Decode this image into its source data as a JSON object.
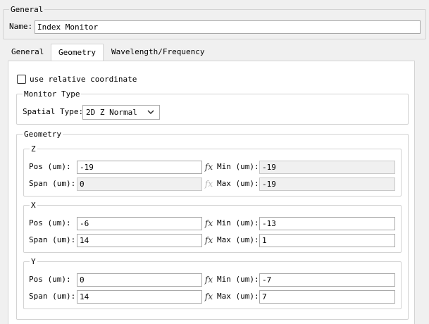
{
  "general": {
    "title": "General",
    "name_label": "Name:",
    "name_value": "Index Monitor"
  },
  "tabs": [
    {
      "label": "General",
      "active": false
    },
    {
      "label": "Geometry",
      "active": true
    },
    {
      "label": "Wavelength/Frequency",
      "active": false
    }
  ],
  "relative_coordinate": {
    "label": "use relative coordinate",
    "checked": false
  },
  "monitor_type": {
    "title": "Monitor Type",
    "spatial_type_label": "Spatial Type:",
    "spatial_type_value": "2D Z Normal"
  },
  "geometry": {
    "title": "Geometry",
    "fx_glyph": "fx",
    "z": {
      "title": "Z",
      "pos_label": "Pos (um):",
      "pos_value": "-19",
      "span_label": "Span (um):",
      "span_value": "0",
      "min_label": "Min (um):",
      "min_value": "-19",
      "max_label": "Max (um):",
      "max_value": "-19"
    },
    "x": {
      "title": "X",
      "pos_label": "Pos (um):",
      "pos_value": "-6",
      "span_label": "Span (um):",
      "span_value": "14",
      "min_label": "Min (um):",
      "min_value": "-13",
      "max_label": "Max (um):",
      "max_value": "1"
    },
    "y": {
      "title": "Y",
      "pos_label": "Pos (um):",
      "pos_value": "0",
      "span_label": "Span (um):",
      "span_value": "14",
      "min_label": "Min (um):",
      "min_value": "-7",
      "max_label": "Max (um):",
      "max_value": "7"
    }
  }
}
